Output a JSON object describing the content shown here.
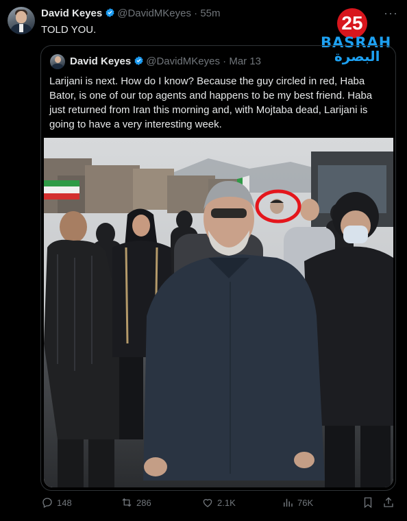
{
  "tweet": {
    "author_name": "David Keyes",
    "handle": "@DavidMKeyes",
    "separator": "·",
    "time": "55m",
    "text": "TOLD YOU."
  },
  "quoted_tweet": {
    "author_name": "David Keyes",
    "handle": "@DavidMKeyes",
    "separator": "·",
    "date": "Mar 13",
    "text": "Larijani is next. How do I know? Because the guy circled in red, Haba Bator, is one of our top agents and happens to be my best friend. Haba just returned from Iran this morning and, with Mojtaba dead, Larijani is going to have a very interesting week."
  },
  "watermark": {
    "number": "25",
    "english": "BASRAH",
    "arabic": "البصرة"
  },
  "actions": {
    "replies": "148",
    "reposts": "286",
    "likes": "2.1K",
    "views": "76K"
  },
  "icons": {
    "verified": "verified-badge-icon",
    "more": "more-options-icon",
    "reply": "reply-icon",
    "repost": "repost-icon",
    "like": "like-icon",
    "views": "views-icon",
    "bookmark": "bookmark-icon",
    "share": "share-icon"
  },
  "colors": {
    "background": "#000000",
    "text": "#e7e9ea",
    "muted": "#71767b",
    "verified": "#1d9bf0",
    "circle_annotation": "#e4161c"
  }
}
